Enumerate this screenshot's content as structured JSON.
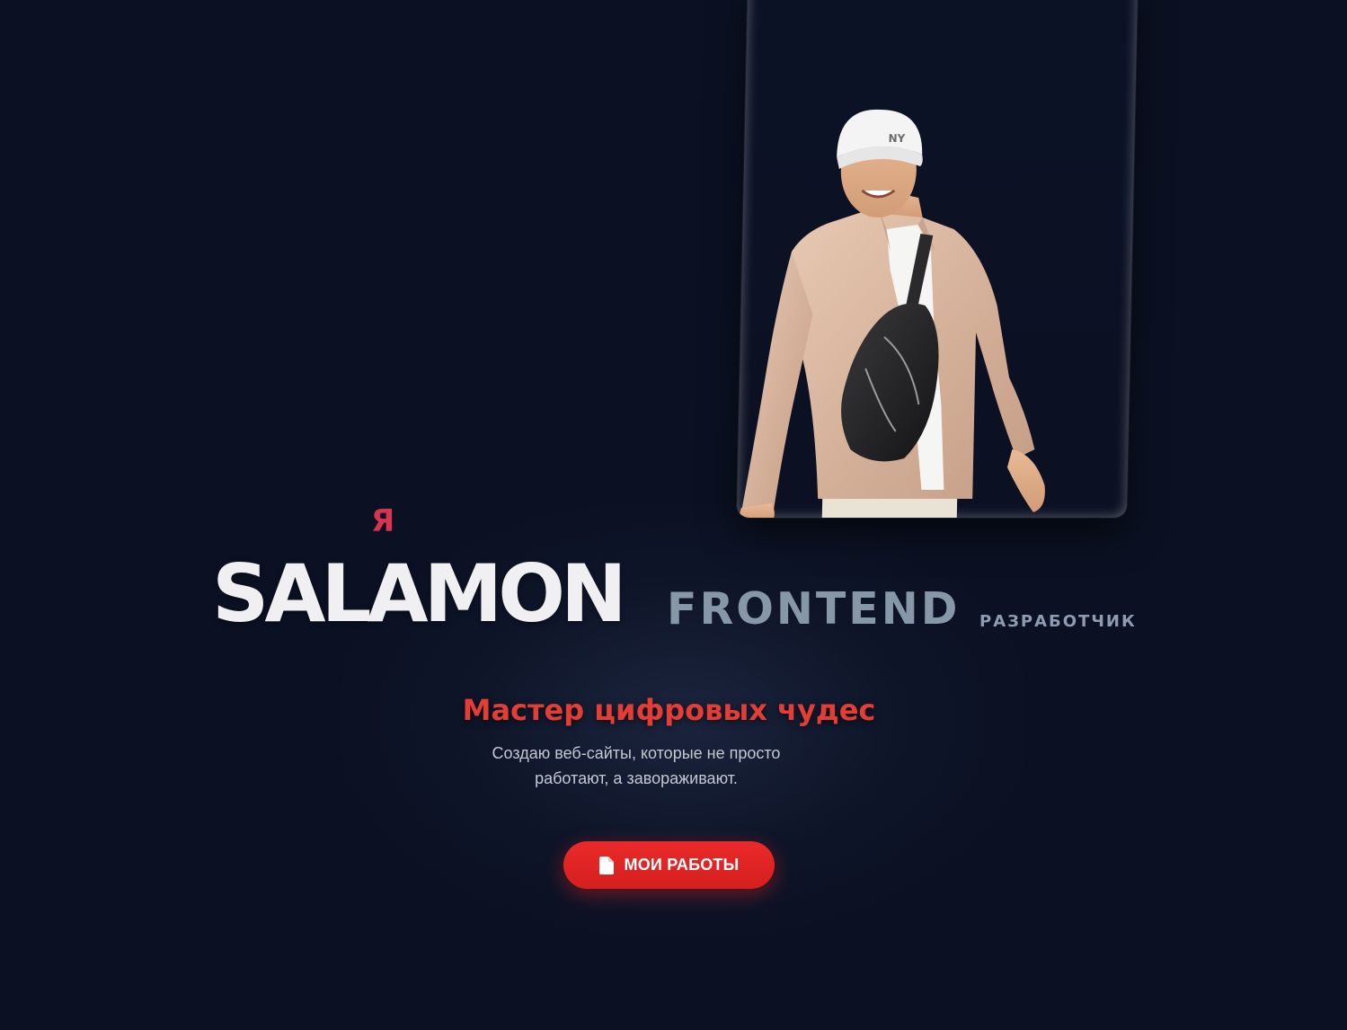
{
  "hero": {
    "pronoun": "Я",
    "name": "SALAMON",
    "specialty": "FRONTEND",
    "role": "РАЗРАБОТЧИК",
    "tagline": "Мастер цифровых чудес",
    "description_line1": "Создаю веб-сайты, которые не просто",
    "description_line2": "работают, а завораживают.",
    "cta_label": "МОИ РАБОТЫ",
    "cta_icon": "document-icon"
  },
  "photo": {
    "subject": "portrait-photo",
    "cap_logo": "NY"
  },
  "colors": {
    "background": "#0b1122",
    "accent": "#e33d35",
    "pronoun": "#d8334f",
    "specialty": "#8797aa",
    "name": "#f0f0f2"
  }
}
